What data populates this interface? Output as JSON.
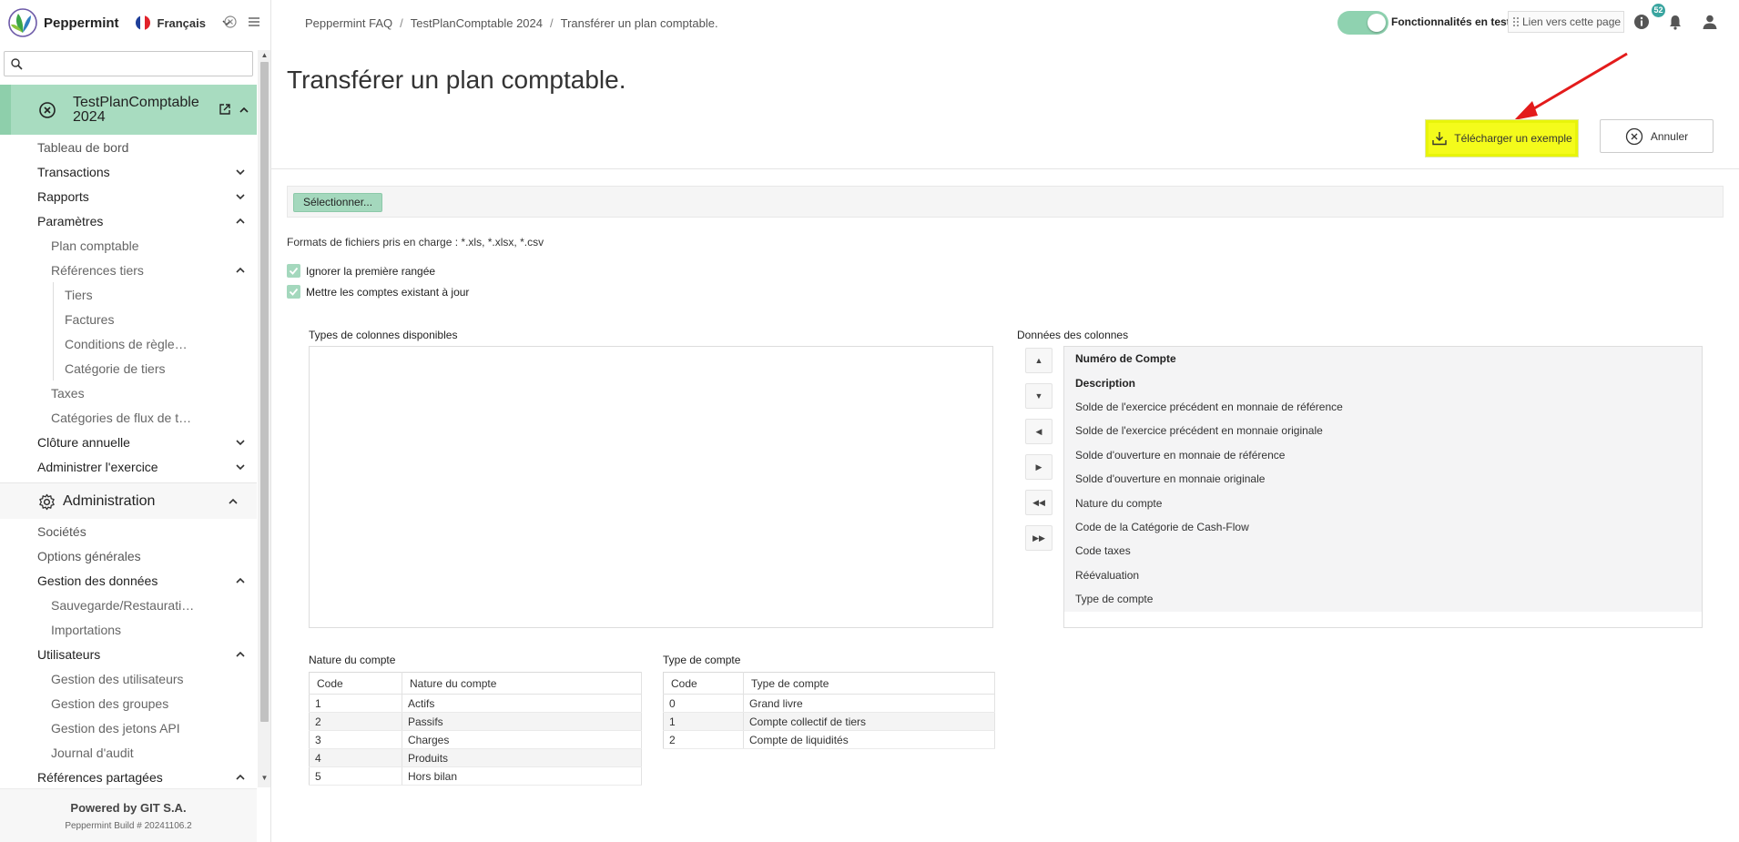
{
  "app": {
    "name": "Peppermint",
    "language": "Français"
  },
  "sidebar": {
    "search_placeholder": "",
    "company": {
      "name": "TestPlanComptable 2024"
    },
    "items": [
      {
        "label": "Tableau de bord",
        "level": 0
      },
      {
        "label": "Transactions",
        "level": 1,
        "toggle": "down"
      },
      {
        "label": "Rapports",
        "level": 1,
        "toggle": "down"
      },
      {
        "label": "Paramètres",
        "level": 1,
        "toggle": "up"
      },
      {
        "label": "Plan comptable",
        "level": 2
      },
      {
        "label": "Références tiers",
        "level": 2,
        "toggle": "up"
      },
      {
        "label": "Tiers",
        "level": 3
      },
      {
        "label": "Factures",
        "level": 3
      },
      {
        "label": "Conditions de règle…",
        "level": 3
      },
      {
        "label": "Catégorie de tiers",
        "level": 3
      },
      {
        "label": "Taxes",
        "level": 2
      },
      {
        "label": "Catégories de flux de t…",
        "level": 2
      },
      {
        "label": "Clôture annuelle",
        "level": 1,
        "toggle": "down"
      },
      {
        "label": "Administrer l'exercice",
        "level": 1,
        "toggle": "down"
      }
    ],
    "admin": {
      "title": "Administration",
      "items": [
        {
          "label": "Sociétés",
          "level": 0
        },
        {
          "label": "Options générales",
          "level": 0
        },
        {
          "label": "Gestion des données",
          "level": 1,
          "toggle": "up"
        },
        {
          "label": "Sauvegarde/Restaurati…",
          "level": 2
        },
        {
          "label": "Importations",
          "level": 2
        },
        {
          "label": "Utilisateurs",
          "level": 1,
          "toggle": "up"
        },
        {
          "label": "Gestion des utilisateurs",
          "level": 2
        },
        {
          "label": "Gestion des groupes",
          "level": 2
        },
        {
          "label": "Gestion des jetons API",
          "level": 2
        },
        {
          "label": "Journal d'audit",
          "level": 2
        },
        {
          "label": "Références partagées",
          "level": 1,
          "toggle": "up"
        }
      ]
    },
    "footer": {
      "powered": "Powered by GIT S.A.",
      "build": "Peppermint Build # 20241106.2"
    }
  },
  "topbar": {
    "breadcrumb": [
      "Peppermint FAQ",
      "TestPlanComptable 2024",
      "Transférer un plan comptable."
    ],
    "feature_toggle_label": "Fonctionnalités en test",
    "link_button": "Lien vers cette page",
    "notifications_count": "52"
  },
  "main": {
    "title": "Transférer un plan comptable.",
    "download_button": "Télécharger un exemple",
    "cancel_button": "Annuler",
    "select_button": "Sélectionner...",
    "formats_text": "Formats de fichiers pris en charge : *.xls, *.xlsx, *.csv",
    "checkbox_ignore_first": "Ignorer la première rangée",
    "checkbox_update": "Mettre les comptes existant à jour",
    "available_label": "Types de colonnes disponibles",
    "columns_label": "Données des colonnes",
    "columns": [
      {
        "label": "Numéro de Compte",
        "bold": true
      },
      {
        "label": "Description",
        "bold": true
      },
      {
        "label": "Solde de l'exercice précédent en monnaie de référence",
        "bold": false
      },
      {
        "label": "Solde de l'exercice précédent en monnaie originale",
        "bold": false
      },
      {
        "label": "Solde d'ouverture en monnaie de référence",
        "bold": false
      },
      {
        "label": "Solde d'ouverture en monnaie originale",
        "bold": false
      },
      {
        "label": "Nature du compte",
        "bold": false
      },
      {
        "label": "Code de la Catégorie de Cash-Flow",
        "bold": false
      },
      {
        "label": "Code taxes",
        "bold": false
      },
      {
        "label": "Réévaluation",
        "bold": false
      },
      {
        "label": "Type de compte",
        "bold": false
      }
    ],
    "nature_table": {
      "title": "Nature du compte",
      "headers": [
        "Code",
        "Nature du compte"
      ],
      "rows": [
        [
          "1",
          "Actifs"
        ],
        [
          "2",
          "Passifs"
        ],
        [
          "3",
          "Charges"
        ],
        [
          "4",
          "Produits"
        ],
        [
          "5",
          "Hors bilan"
        ]
      ]
    },
    "type_table": {
      "title": "Type de compte",
      "headers": [
        "Code",
        "Type de compte"
      ],
      "rows": [
        [
          "0",
          "Grand livre"
        ],
        [
          "1",
          "Compte collectif de tiers"
        ],
        [
          "2",
          "Compte de liquidités"
        ]
      ]
    }
  },
  "colors": {
    "accent": "#a4d8bd",
    "highlight": "#f4fb1b",
    "arrow": "#e31b1b"
  }
}
